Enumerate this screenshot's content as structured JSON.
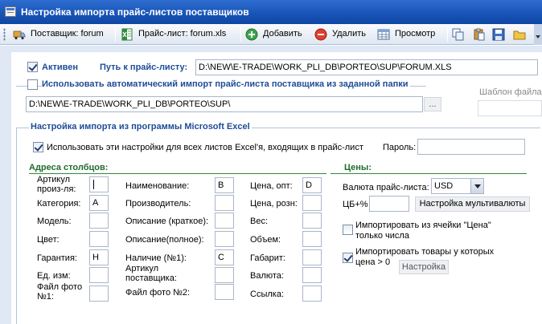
{
  "window": {
    "title": "Настройка импорта прайс-листов поставщиков"
  },
  "toolbar": {
    "supplier_label": "Поставщик: forum",
    "pricelist_label": "Прайс-лист: forum.xls",
    "add_label": "Добавить",
    "delete_label": "Удалить",
    "view_label": "Просмотр"
  },
  "top": {
    "active_label": "Активен",
    "active_checked": true,
    "path_label": "Путь к прайс-листу:",
    "path_value": "D:\\NEW\\E-TRADE\\WORK_PLI_DB\\PORTEO\\SUP\\FORUM.XLS",
    "auto_import_label": "Использовать автоматический импорт прайс-листа поставщика из заданной папки",
    "auto_import_checked": false,
    "folder_value": "D:\\NEW\\E-TRADE\\WORK_PLI_DB\\PORTEO\\SUP\\",
    "browse_label": "...",
    "file_template_label": "Шаблон файла:"
  },
  "excel": {
    "section_title": "Настройка импорта из программы Microsoft Excel",
    "use_for_all_label": "Использовать эти настройки для всех листов Excel'я, входящих в прайс-лист",
    "use_for_all_checked": true,
    "password_label": "Пароль:",
    "password_value": ""
  },
  "columns": {
    "title": "Адреса столбцов:",
    "col1": [
      {
        "label": "Артикул\nпроиз-ля:",
        "value": ""
      },
      {
        "label": "Категория:",
        "value": "A"
      },
      {
        "label": "Модель:",
        "value": ""
      },
      {
        "label": "Цвет:",
        "value": ""
      },
      {
        "label": "Гарантия:",
        "value": "H"
      },
      {
        "label": "Ед. изм:",
        "value": ""
      },
      {
        "label": "Файл фото\n№1:",
        "value": ""
      }
    ],
    "col2": [
      {
        "label": "Наименование:",
        "value": "B"
      },
      {
        "label": "Производитель:",
        "value": ""
      },
      {
        "label": "Описание (краткое):",
        "value": ""
      },
      {
        "label": "Описание(полное):",
        "value": ""
      },
      {
        "label": "Наличие (№1):",
        "value": "C"
      },
      {
        "label": "Артикул\nпоставщика:",
        "value": ""
      },
      {
        "label": "Файл фото №2:",
        "value": ""
      }
    ],
    "col3": [
      {
        "label": "Цена, опт:",
        "value": "D"
      },
      {
        "label": "Цена, розн:",
        "value": ""
      },
      {
        "label": "Вес:",
        "value": ""
      },
      {
        "label": "Объем:",
        "value": ""
      },
      {
        "label": "Габарит:",
        "value": ""
      },
      {
        "label": "Валюта:",
        "value": ""
      },
      {
        "label": "Ссылка:",
        "value": ""
      }
    ]
  },
  "prices": {
    "title": "Цены:",
    "currency_label": "Валюта прайс-листа:",
    "currency_value": "USD",
    "cb_label": "ЦБ+%",
    "cb_value": "",
    "multicurrency_label": "Настройка мультивалюты",
    "import_numbers_label": "Импортировать из ячейки \"Цена\"\nтолько числа",
    "import_numbers_checked": false,
    "import_positive_label": "Импортировать товары у которых\nцена > 0",
    "import_positive_checked": true,
    "settings_label": "Настройка"
  }
}
